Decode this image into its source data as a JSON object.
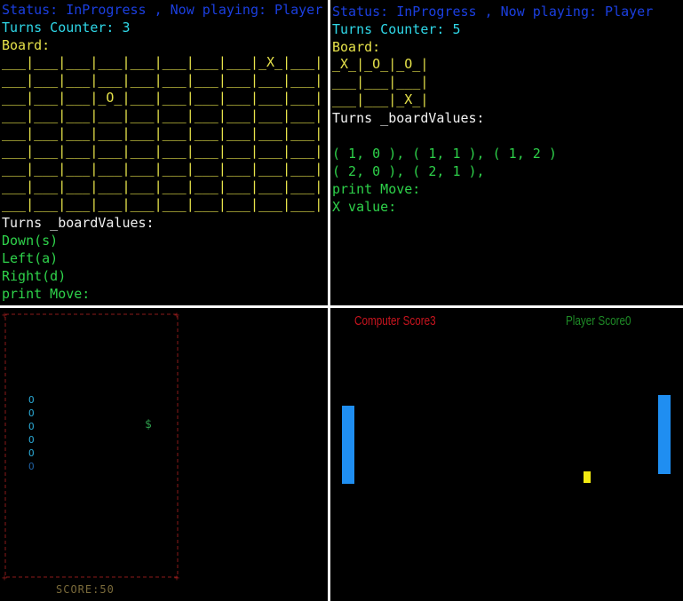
{
  "ttt_large": {
    "status_line": "Status: InProgress , Now playing: Player",
    "turns_line": "Turns Counter: 3",
    "board_label": "Board:",
    "board_rows": [
      "___|___|___|___|___|___|___|___|_X_|___|",
      "___|___|___|___|___|___|___|___|___|___|",
      "___|___|___|_O_|___|___|___|___|___|___|",
      "___|___|___|___|___|___|___|___|___|___|",
      "___|___|___|___|___|___|___|___|___|___|",
      "___|___|___|___|___|___|___|___|___|___|",
      "___|___|___|___|___|___|___|___|___|___|",
      "___|___|___|___|___|___|___|___|___|___|",
      "___|___|___|___|___|___|___|___|___|___|"
    ],
    "board_values_label": "Turns _boardValues:",
    "moves": [
      "Down(s)",
      "Left(a)",
      "Right(d)"
    ],
    "prompt": "print Move:"
  },
  "ttt_small": {
    "status_line": "Status: InProgress , Now playing: Player",
    "turns_line": "Turns Counter: 5",
    "board_label": "Board:",
    "board_rows": [
      "_X_|_O_|_O_|",
      "___|___|___|",
      "___|___|_X_|"
    ],
    "board_values_label": "Turns _boardValues:",
    "values_line_1": "( 1, 0 ), ( 1, 1 ), ( 1, 2 )",
    "values_line_2": "( 2, 0 ), ( 2, 1 ),",
    "prompt": "print Move:",
    "x_prompt": "X value:"
  },
  "snake": {
    "segment_char": "O",
    "segment_count": 6,
    "food_char": "$",
    "score_text": "SCORE:50"
  },
  "pong": {
    "computer_score_text": "Computer Score3",
    "player_score_text": "Player Score0",
    "colors": {
      "computer": "#c8141e",
      "player": "#1e8a26",
      "paddle": "#1f8ef1",
      "ball": "#f2ea12"
    }
  }
}
